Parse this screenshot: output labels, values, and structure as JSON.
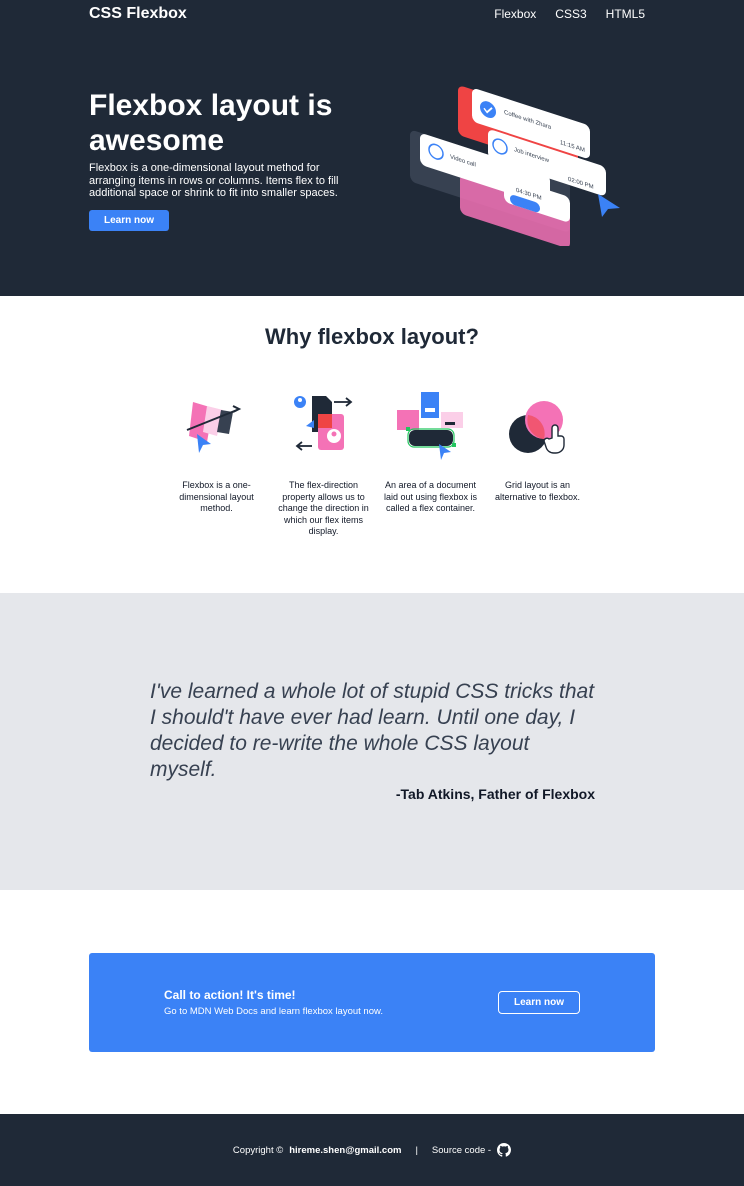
{
  "nav": {
    "brand": "CSS Flexbox",
    "links": [
      "Flexbox",
      "CSS3",
      "HTML5"
    ]
  },
  "hero": {
    "title": "Flexbox layout is awesome",
    "description": "Flexbox is a one-dimensional layout method for arranging items in rows or columns. Items flex to fill additional space or shrink to fit into smaller spaces.",
    "button": "Learn now",
    "illustration": {
      "item1_title": "Coffee with Zhara",
      "item1_time": "11:15 AM",
      "item2_title": "Job interview",
      "item2_time": "02:00 PM",
      "item3_title": "Video call",
      "item3_time": "04:30 PM"
    }
  },
  "features": {
    "title": "Why flexbox layout?",
    "items": [
      {
        "icon": "flex-shapes-icon",
        "text": "Flexbox is a one-dimensional layout method."
      },
      {
        "icon": "flex-direction-icon",
        "text": "The flex-direction property allows us to change the direction in which our flex items display."
      },
      {
        "icon": "flex-container-icon",
        "text": "An area of a document laid out using flexbox is called a flex container."
      },
      {
        "icon": "grid-layout-icon",
        "text": "Grid layout is an alternative to flexbox."
      }
    ]
  },
  "quote": {
    "text": "I've learned a whole lot of stupid CSS tricks that I should't have ever had learn. Until one day, I decided to re-write the whole CSS layout myself.",
    "author": "-Tab Atkins, Father of Flexbox"
  },
  "cta": {
    "title": "Call to action! It's time!",
    "subtitle": "Go to MDN Web Docs and learn flexbox layout now.",
    "button": "Learn now"
  },
  "footer": {
    "copyright": "Copyright ©",
    "email": "hireme.shen@gmail.com",
    "separator": "|",
    "source": "Source code -",
    "icon": "github-icon"
  },
  "colors": {
    "dark": "#1f2937",
    "accent": "#3b82f6",
    "quote_bg": "#e5e7eb",
    "pink": "#f472b6"
  }
}
